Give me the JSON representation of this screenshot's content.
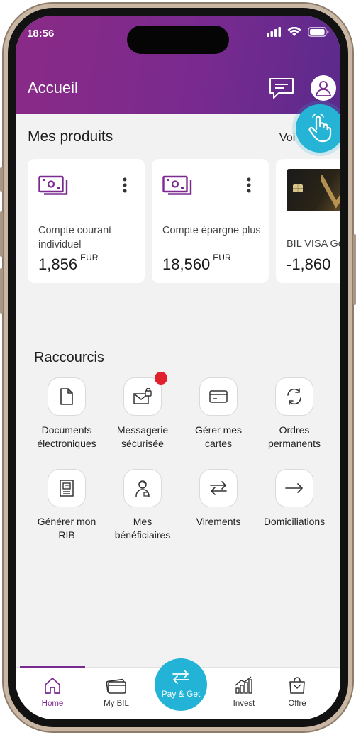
{
  "status_bar": {
    "time": "18:56"
  },
  "header": {
    "title": "Accueil"
  },
  "products": {
    "title": "Mes produits",
    "see_all": "Voi",
    "cards": [
      {
        "name": "Compte courant individuel",
        "amount": "1,856",
        "currency": "EUR"
      },
      {
        "name": "Compte épargne plus",
        "amount": "18,560",
        "currency": "EUR"
      },
      {
        "name": "BIL VISA Go",
        "amount": "-1,860"
      }
    ]
  },
  "shortcuts": {
    "title": "Raccourcis",
    "items": [
      {
        "label": "Documents électroniques"
      },
      {
        "label": "Messagerie sécurisée"
      },
      {
        "label": "Gérer mes cartes"
      },
      {
        "label": "Ordres permanents"
      },
      {
        "label": "Générer mon RIB"
      },
      {
        "label": "Mes bénéficiaires"
      },
      {
        "label": "Virements"
      },
      {
        "label": "Domiciliations"
      }
    ]
  },
  "bottom_nav": {
    "items": [
      {
        "label": "Home"
      },
      {
        "label": "My BIL"
      },
      {
        "label": "Pay & Get"
      },
      {
        "label": "Invest"
      },
      {
        "label": "Offre"
      }
    ]
  },
  "colors": {
    "brand_purple": "#7b2a90",
    "accent_cyan": "#25b4d6",
    "notification_red": "#e0202d"
  }
}
